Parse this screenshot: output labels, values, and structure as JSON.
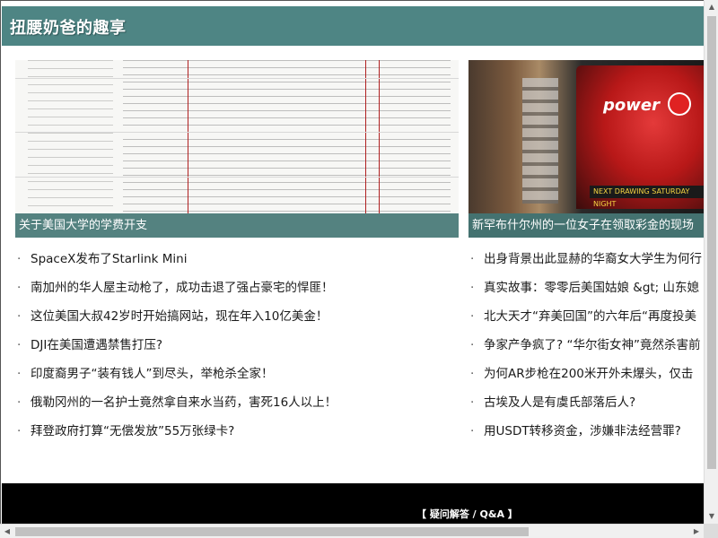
{
  "header": {
    "site_title": "扭腰奶爸的趣享"
  },
  "featured": [
    {
      "caption": "关于美国大学的学费开支"
    },
    {
      "caption": "新罕布什尔州的一位女子在领取彩金的现场",
      "image_text": {
        "logo": "power",
        "banner": "NEXT DRAWING SATURDAY NIGHT"
      }
    }
  ],
  "articles_left": [
    "SpaceX发布了Starlink Mini",
    "南加州的华人屋主动枪了，成功击退了强占豪宅的悍匪！",
    "这位美国大叔42岁时开始搞网站，现在年入10亿美金！",
    "DJI在美国遭遇禁售打压?",
    "印度裔男子“装有钱人”到尽头，举枪杀全家！",
    "俄勒冈州的一名护士竟然拿自来水当药，害死16人以上！",
    "拜登政府打算“无偿发放”55万张绿卡?"
  ],
  "articles_right": [
    "出身背景出此显赫的华裔女大学生为何行",
    "真实故事：零零后美国姑娘 &gt; 山东媳",
    "北大天才“弃美回国”的六年后“再度投美",
    "争家产争疯了? “华尔街女神”竟然杀害前",
    "为何AR步枪在200米开外未爆头，仅击",
    "古埃及人是有虞氏部落后人?",
    "用USDT转移资金，涉嫌非法经营罪?"
  ],
  "footer": {
    "link_label": "【 疑问解答 / Q&A 】"
  },
  "bullet_char": "·",
  "scrollbar": {
    "up": "▲",
    "down": "▼",
    "left": "◀",
    "right": "▶"
  },
  "colors": {
    "header_bg": "#4e8584",
    "caption_bg": "#467876",
    "footer_bg": "#000000"
  }
}
